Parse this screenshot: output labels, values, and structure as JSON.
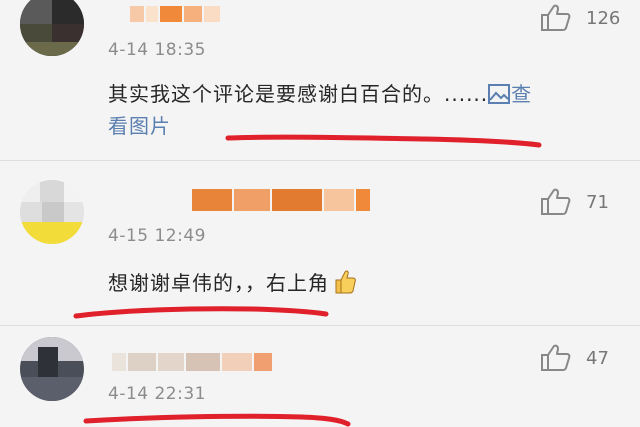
{
  "comments": [
    {
      "time": "4-14 18:35",
      "text_line1": "其实我这个评论是要感谢白百合的。......",
      "link_first": "查",
      "link_second": "看图片",
      "likes": "126",
      "like_icon": "thumb-up-icon"
    },
    {
      "time": "4-15 12:49",
      "text": "想谢谢卓伟的，，右上角",
      "emoji": "thumbs-up-emoji",
      "likes": "71",
      "like_icon": "thumb-up-icon"
    },
    {
      "time": "4-14 22:31",
      "likes": "47",
      "like_icon": "thumb-up-icon"
    }
  ],
  "colors": {
    "underline": "#e0202a",
    "link": "#5b7fb0",
    "name_blur": "#f08a3a"
  }
}
